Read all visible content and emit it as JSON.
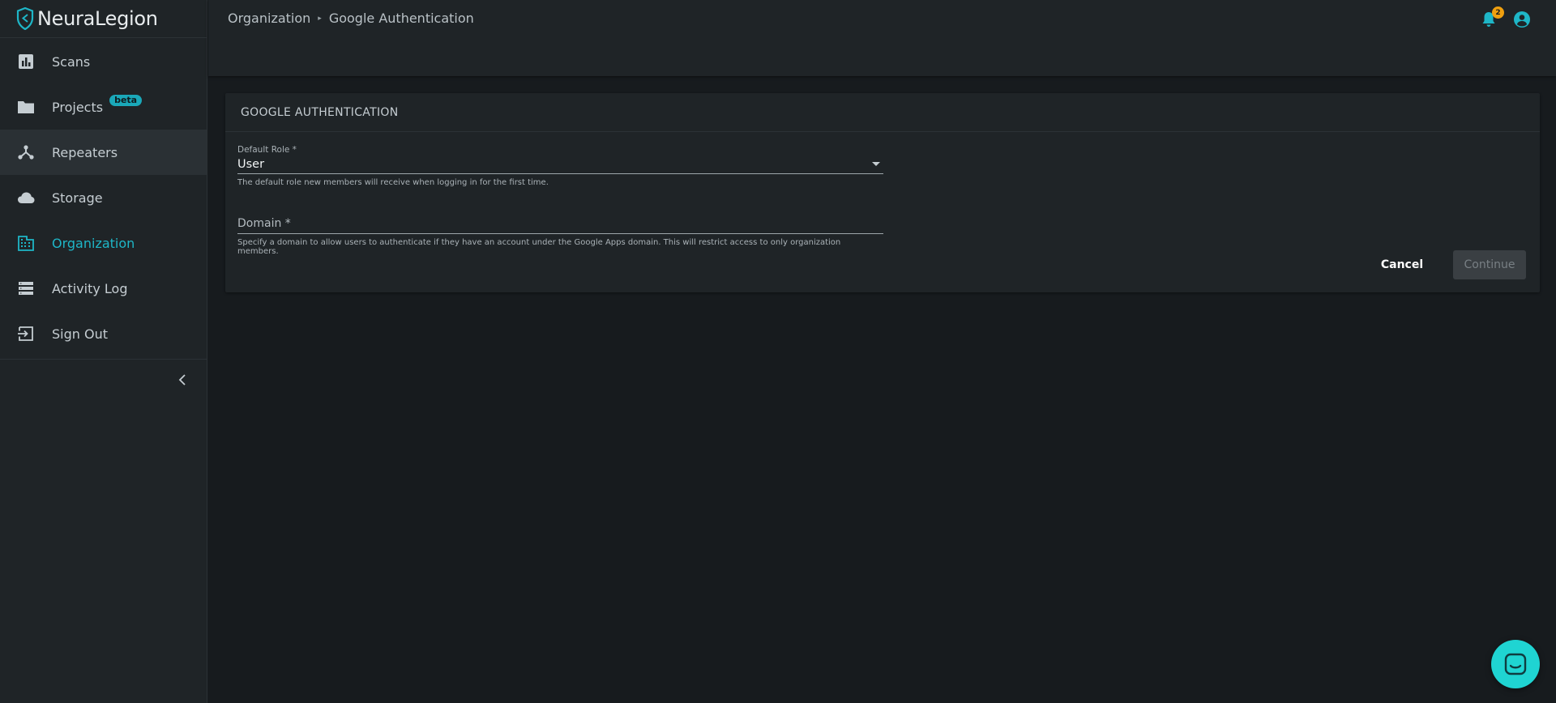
{
  "brand": {
    "name": "NeuraLegion",
    "accent": "#1eb6c7"
  },
  "sidebar": {
    "items": [
      {
        "label": "Scans",
        "icon": "bar-chart-icon"
      },
      {
        "label": "Projects",
        "icon": "folder-icon",
        "badge": "beta"
      },
      {
        "label": "Repeaters",
        "icon": "network-icon"
      },
      {
        "label": "Storage",
        "icon": "cloud-icon"
      },
      {
        "label": "Organization",
        "icon": "building-icon",
        "active": true
      },
      {
        "label": "Activity Log",
        "icon": "list-icon"
      },
      {
        "label": "Sign Out",
        "icon": "sign-out-icon"
      }
    ],
    "collapse_icon": "chevron-left-icon"
  },
  "header": {
    "breadcrumb": [
      "Organization",
      "Google Authentication"
    ],
    "breadcrumb_separator": "▸",
    "notifications_count": "2"
  },
  "card": {
    "title": "GOOGLE AUTHENTICATION",
    "default_role": {
      "label": "Default Role *",
      "value": "User",
      "hint": "The default role new members will receive when logging in for the first time."
    },
    "domain": {
      "placeholder": "Domain *",
      "value": "",
      "hint": "Specify a domain to allow users to authenticate if they have an account under the Google Apps domain. This will restrict access to only organization members."
    },
    "cancel_label": "Cancel",
    "continue_label": "Continue"
  },
  "colors": {
    "background": "#171b1e",
    "panel": "#1f2427",
    "notification_badge": "#f0a00f",
    "chat_launcher": "#1fd4d2"
  }
}
